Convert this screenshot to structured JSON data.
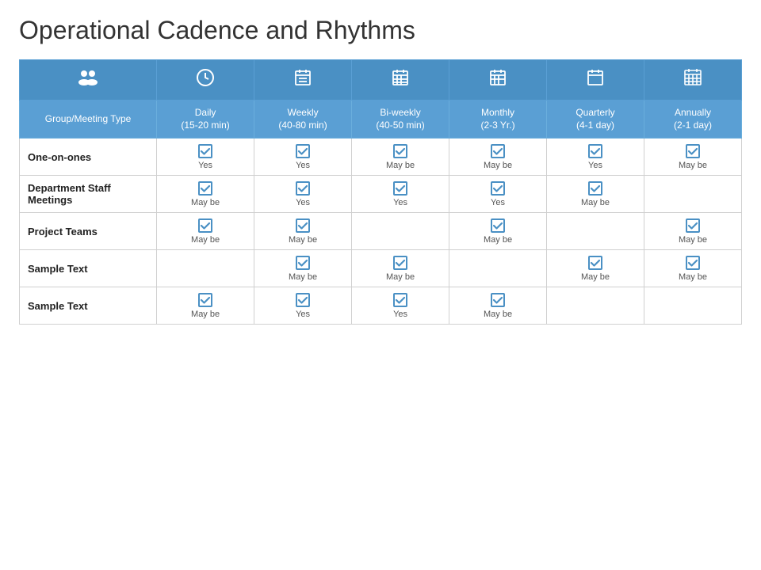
{
  "title": "Operational Cadence and Rhythms",
  "table": {
    "icons": [
      "👥",
      "🕐",
      "📅",
      "📆",
      "📅",
      "📋",
      "📊"
    ],
    "icon_labels": [
      "group-icon",
      "clock-icon",
      "calendar-weekly-icon",
      "calendar-biweekly-icon",
      "calendar-monthly-icon",
      "calendar-quarterly-icon",
      "calendar-annually-icon"
    ],
    "headers": [
      "Group/Meeting Type",
      "Daily\n(15-20 min)",
      "Weekly\n(40-80 min)",
      "Bi-weekly\n(40-50 min)",
      "Monthly\n(2-3 Yr.)",
      "Quarterly\n(4-1 day)",
      "Annually\n(2-1 day)"
    ],
    "rows": [
      {
        "label": "One-on-ones",
        "cells": [
          {
            "checked": true,
            "text": "Yes"
          },
          {
            "checked": true,
            "text": "Yes"
          },
          {
            "checked": true,
            "text": "May be"
          },
          {
            "checked": true,
            "text": "May be"
          },
          {
            "checked": true,
            "text": "Yes"
          },
          {
            "checked": true,
            "text": "May be"
          }
        ]
      },
      {
        "label": "Department Staff Meetings",
        "cells": [
          {
            "checked": true,
            "text": "May be"
          },
          {
            "checked": true,
            "text": "Yes"
          },
          {
            "checked": true,
            "text": "Yes"
          },
          {
            "checked": true,
            "text": "Yes"
          },
          {
            "checked": true,
            "text": "May be"
          },
          {
            "checked": false,
            "text": ""
          }
        ]
      },
      {
        "label": "Project Teams",
        "cells": [
          {
            "checked": true,
            "text": "May be"
          },
          {
            "checked": true,
            "text": "May be"
          },
          {
            "checked": false,
            "text": ""
          },
          {
            "checked": true,
            "text": "May be"
          },
          {
            "checked": false,
            "text": ""
          },
          {
            "checked": true,
            "text": "May be"
          }
        ]
      },
      {
        "label": "Sample Text",
        "cells": [
          {
            "checked": false,
            "text": ""
          },
          {
            "checked": true,
            "text": "May be"
          },
          {
            "checked": true,
            "text": "May be"
          },
          {
            "checked": false,
            "text": ""
          },
          {
            "checked": true,
            "text": "May be"
          },
          {
            "checked": true,
            "text": "May be"
          }
        ]
      },
      {
        "label": "Sample Text",
        "cells": [
          {
            "checked": true,
            "text": "May be"
          },
          {
            "checked": true,
            "text": "Yes"
          },
          {
            "checked": true,
            "text": "Yes"
          },
          {
            "checked": true,
            "text": "May be"
          },
          {
            "checked": false,
            "text": ""
          },
          {
            "checked": false,
            "text": ""
          }
        ]
      }
    ]
  }
}
